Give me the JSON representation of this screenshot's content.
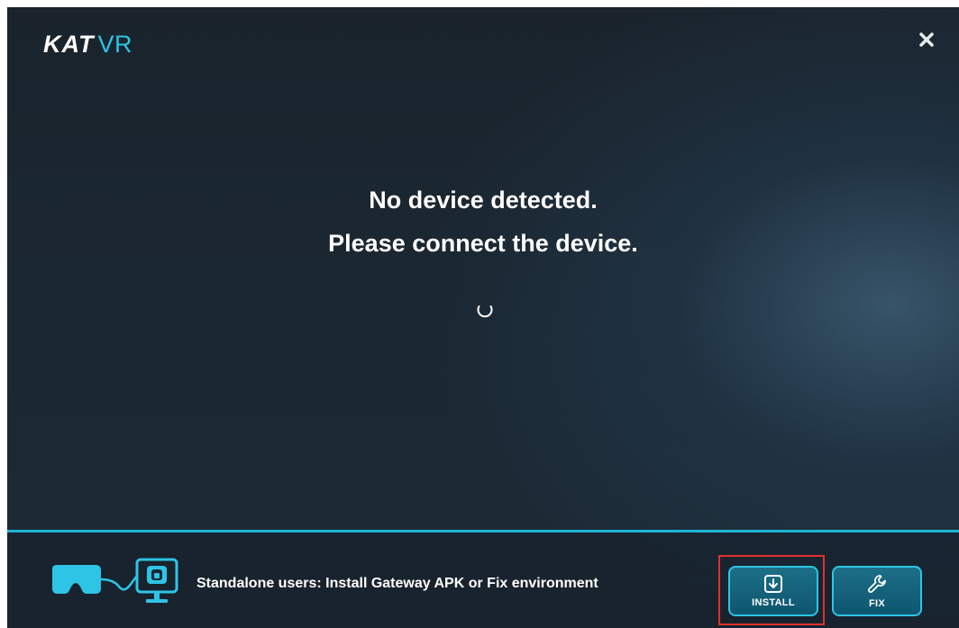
{
  "app": {
    "logo_primary": "KAT",
    "logo_secondary": "VR"
  },
  "status": {
    "line1": "No device detected.",
    "line2": "Please connect the device."
  },
  "footer": {
    "message": "Standalone users: Install Gateway APK or Fix environment",
    "install_label": "INSTALL",
    "fix_label": "FIX"
  },
  "colors": {
    "accent": "#2ec4e6",
    "background": "#1b2833",
    "highlight": "#e0312b"
  },
  "icons": {
    "close": "close-icon",
    "spinner": "loading-spinner-icon",
    "headset": "vr-headset-icon",
    "monitor": "monitor-icon",
    "install": "download-box-icon",
    "fix": "wrench-icon"
  }
}
